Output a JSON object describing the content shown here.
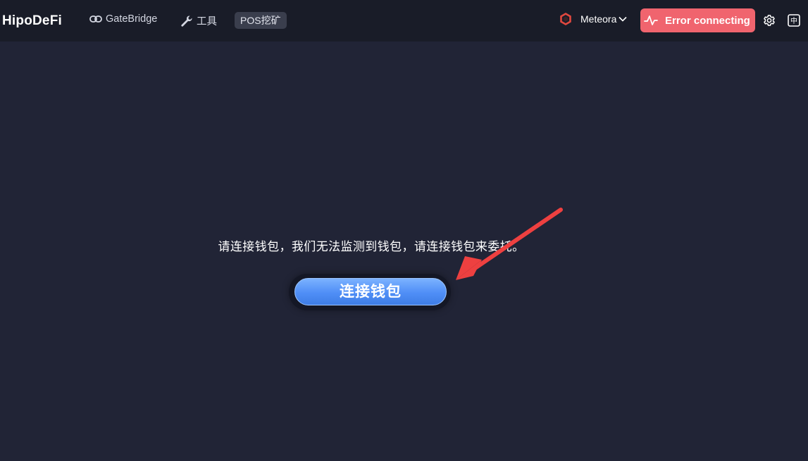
{
  "header": {
    "brand": "HipoDeFi",
    "nav": {
      "gatebridge": "GateBridge",
      "tools": "工具",
      "pos_mining": "POS挖矿"
    },
    "network": {
      "name": "Meteora",
      "logo_icon": "meteora-logo-icon",
      "chevron_icon": "chevron-down-icon"
    },
    "status": {
      "label": "Error connecting",
      "icon": "pulse-icon",
      "color": "#f0646e"
    },
    "settings_icon": "gear-icon",
    "language_icon": "language-zh-icon",
    "language_label": "中"
  },
  "main": {
    "message": "请连接钱包，我们无法监测到钱包，请连接钱包来委托。",
    "connect_button": "连接钱包",
    "annotation": "red-arrow-pointer"
  },
  "colors": {
    "background": "#212436",
    "topbar": "#191c28",
    "accent": "#4f8ef6",
    "error": "#f0646e",
    "arrow": "#ee4040"
  }
}
